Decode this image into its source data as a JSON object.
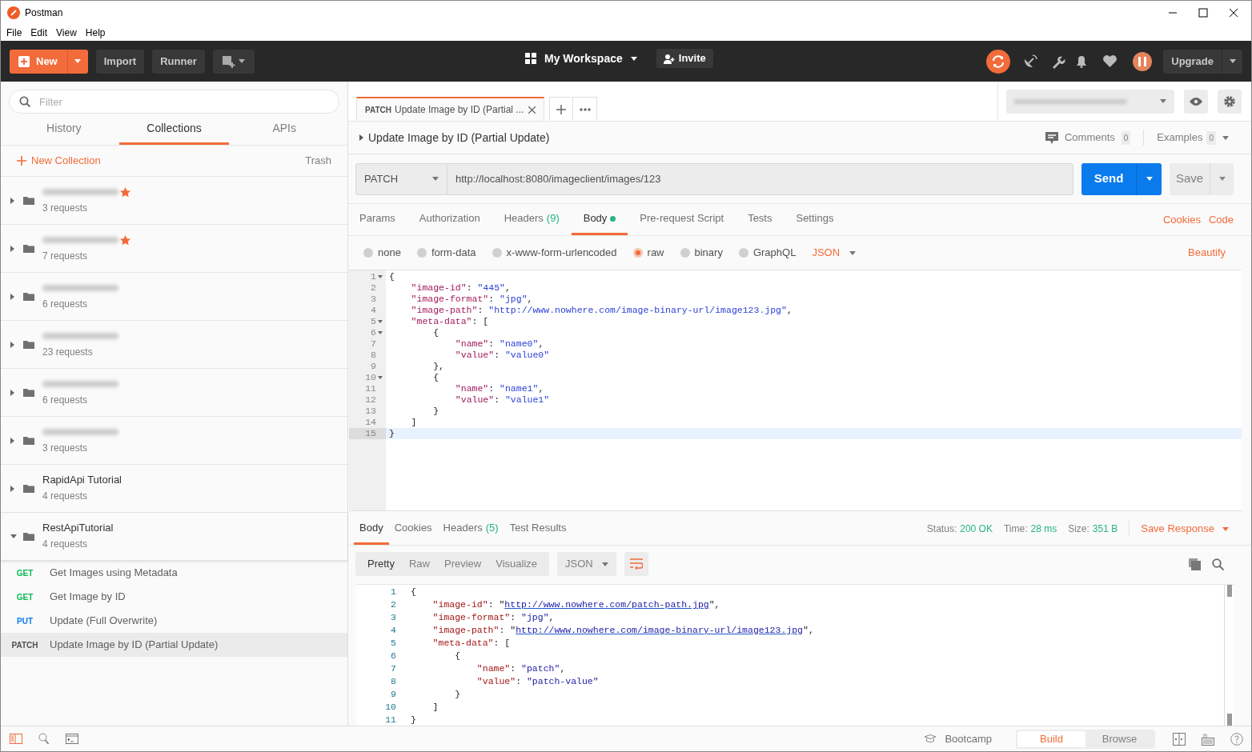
{
  "window": {
    "title": "Postman"
  },
  "menu": [
    "File",
    "Edit",
    "View",
    "Help"
  ],
  "header": {
    "new": "New",
    "import": "Import",
    "runner": "Runner",
    "workspace": "My Workspace",
    "invite": "Invite",
    "upgrade": "Upgrade"
  },
  "sidebar": {
    "filter_placeholder": "Filter",
    "tabs": [
      {
        "label": "History",
        "selected": false
      },
      {
        "label": "Collections",
        "selected": true
      },
      {
        "label": "APIs",
        "selected": false
      }
    ],
    "new_collection": "New Collection",
    "trash": "Trash",
    "collections": [
      {
        "starred": true,
        "count": "3 requests",
        "expanded": false
      },
      {
        "starred": true,
        "count": "7 requests",
        "expanded": false
      },
      {
        "starred": false,
        "count": "6 requests",
        "expanded": false
      },
      {
        "starred": false,
        "count": "23 requests",
        "expanded": false
      },
      {
        "starred": false,
        "count": "6 requests",
        "expanded": false
      },
      {
        "starred": false,
        "count": "3 requests",
        "expanded": false
      },
      {
        "name": "RapidApi Tutorial",
        "starred": false,
        "count": "4 requests",
        "expanded": false
      },
      {
        "name": "RestApiTutorial",
        "starred": false,
        "count": "4 requests",
        "expanded": true,
        "requests": [
          {
            "method": "GET",
            "color": "#0cbb52",
            "name": "Get Images using Metadata",
            "selected": false
          },
          {
            "method": "GET",
            "color": "#0cbb52",
            "name": "Get Image by ID",
            "selected": false
          },
          {
            "method": "PUT",
            "color": "#097bed",
            "name": "Update (Full Overwrite)",
            "selected": false
          },
          {
            "method": "PATCH",
            "color": "#505050",
            "name": "Update Image by ID (Partial Update)",
            "selected": true
          }
        ]
      }
    ]
  },
  "request_tabs": [
    {
      "method": "PATCH",
      "title": "Update Image by ID (Partial ...",
      "selected": true
    }
  ],
  "request": {
    "name": "Update Image by ID (Partial Update)",
    "comments": "Comments",
    "comments_count": "0",
    "examples": "Examples",
    "examples_count": "0",
    "method": "PATCH",
    "url": "http://localhost:8080/imageclient/images/123",
    "send": "Send",
    "save": "Save",
    "tabs": [
      {
        "label": "Params",
        "selected": false,
        "has_content": false
      },
      {
        "label": "Authorization",
        "selected": false,
        "has_content": false
      },
      {
        "label": "Headers",
        "count": "(9)",
        "selected": false,
        "has_content": false
      },
      {
        "label": "Body",
        "selected": true,
        "has_content": true
      },
      {
        "label": "Pre-request Script",
        "selected": false,
        "has_content": false
      },
      {
        "label": "Tests",
        "selected": false,
        "has_content": false
      },
      {
        "label": "Settings",
        "selected": false,
        "has_content": false
      }
    ],
    "links": [
      "Cookies",
      "Code"
    ],
    "body_modes": [
      {
        "label": "none",
        "selected": false
      },
      {
        "label": "form-data",
        "selected": false
      },
      {
        "label": "x-www-form-urlencoded",
        "selected": false
      },
      {
        "label": "raw",
        "selected": true
      },
      {
        "label": "binary",
        "selected": false
      },
      {
        "label": "GraphQL",
        "selected": false
      }
    ],
    "body_format": "JSON",
    "beautify": "Beautify",
    "code": [
      {
        "number": "1",
        "fold": true,
        "current": false,
        "text": "{"
      },
      {
        "number": "2",
        "fold": false,
        "current": false,
        "text": "    \"image-id\": \"445\","
      },
      {
        "number": "3",
        "fold": false,
        "current": false,
        "text": "    \"image-format\": \"jpg\","
      },
      {
        "number": "4",
        "fold": false,
        "current": false,
        "text": "    \"image-path\": \"http://www.nowhere.com/image-binary-url/image123.jpg\","
      },
      {
        "number": "5",
        "fold": true,
        "current": false,
        "text": "    \"meta-data\": ["
      },
      {
        "number": "6",
        "fold": true,
        "current": false,
        "text": "        {"
      },
      {
        "number": "7",
        "fold": false,
        "current": false,
        "text": "            \"name\": \"name0\","
      },
      {
        "number": "8",
        "fold": false,
        "current": false,
        "text": "            \"value\": \"value0\""
      },
      {
        "number": "9",
        "fold": false,
        "current": false,
        "text": "        },"
      },
      {
        "number": "10",
        "fold": true,
        "current": false,
        "text": "        {"
      },
      {
        "number": "11",
        "fold": false,
        "current": false,
        "text": "            \"name\": \"name1\","
      },
      {
        "number": "12",
        "fold": false,
        "current": false,
        "text": "            \"value\": \"value1\""
      },
      {
        "number": "13",
        "fold": false,
        "current": false,
        "text": "        }"
      },
      {
        "number": "14",
        "fold": false,
        "current": false,
        "text": "    ]"
      },
      {
        "number": "15",
        "fold": false,
        "current": true,
        "text": "}"
      }
    ]
  },
  "response": {
    "tabs": [
      {
        "label": "Body",
        "selected": true
      },
      {
        "label": "Cookies",
        "selected": false
      },
      {
        "label": "Headers",
        "count": "(5)",
        "selected": false
      },
      {
        "label": "Test Results",
        "selected": false
      }
    ],
    "status_label": "Status:",
    "status": "200 OK",
    "time_label": "Time:",
    "time": "28 ms",
    "size_label": "Size:",
    "size": "351 B",
    "save_response": "Save Response",
    "views": [
      {
        "label": "Pretty",
        "selected": true
      },
      {
        "label": "Raw",
        "selected": false
      },
      {
        "label": "Preview",
        "selected": false
      },
      {
        "label": "Visualize",
        "selected": false
      }
    ],
    "format": "JSON",
    "code": [
      {
        "number": "1",
        "text": "{"
      },
      {
        "number": "2",
        "text": "    \"image-id\": \"",
        "link": "http://www.nowhere.com/patch-path.jpg",
        "after_link": "\","
      },
      {
        "number": "3",
        "text": "    \"image-format\": \"jpg\","
      },
      {
        "number": "4",
        "text": "    \"image-path\": \"",
        "link": "http://www.nowhere.com/image-binary-url/image123.jpg",
        "after_link": "\","
      },
      {
        "number": "5",
        "text": "    \"meta-data\": ["
      },
      {
        "number": "6",
        "text": "        {"
      },
      {
        "number": "7",
        "text": "            \"name\": \"patch\","
      },
      {
        "number": "8",
        "text": "            \"value\": \"patch-value\""
      },
      {
        "number": "9",
        "text": "        }"
      },
      {
        "number": "10",
        "text": "    ]"
      },
      {
        "number": "11",
        "text": "}"
      }
    ]
  },
  "status_bar": {
    "bootcamp": "Bootcamp",
    "modes": [
      {
        "label": "Build",
        "selected": true
      },
      {
        "label": "Browse",
        "selected": false
      }
    ]
  }
}
